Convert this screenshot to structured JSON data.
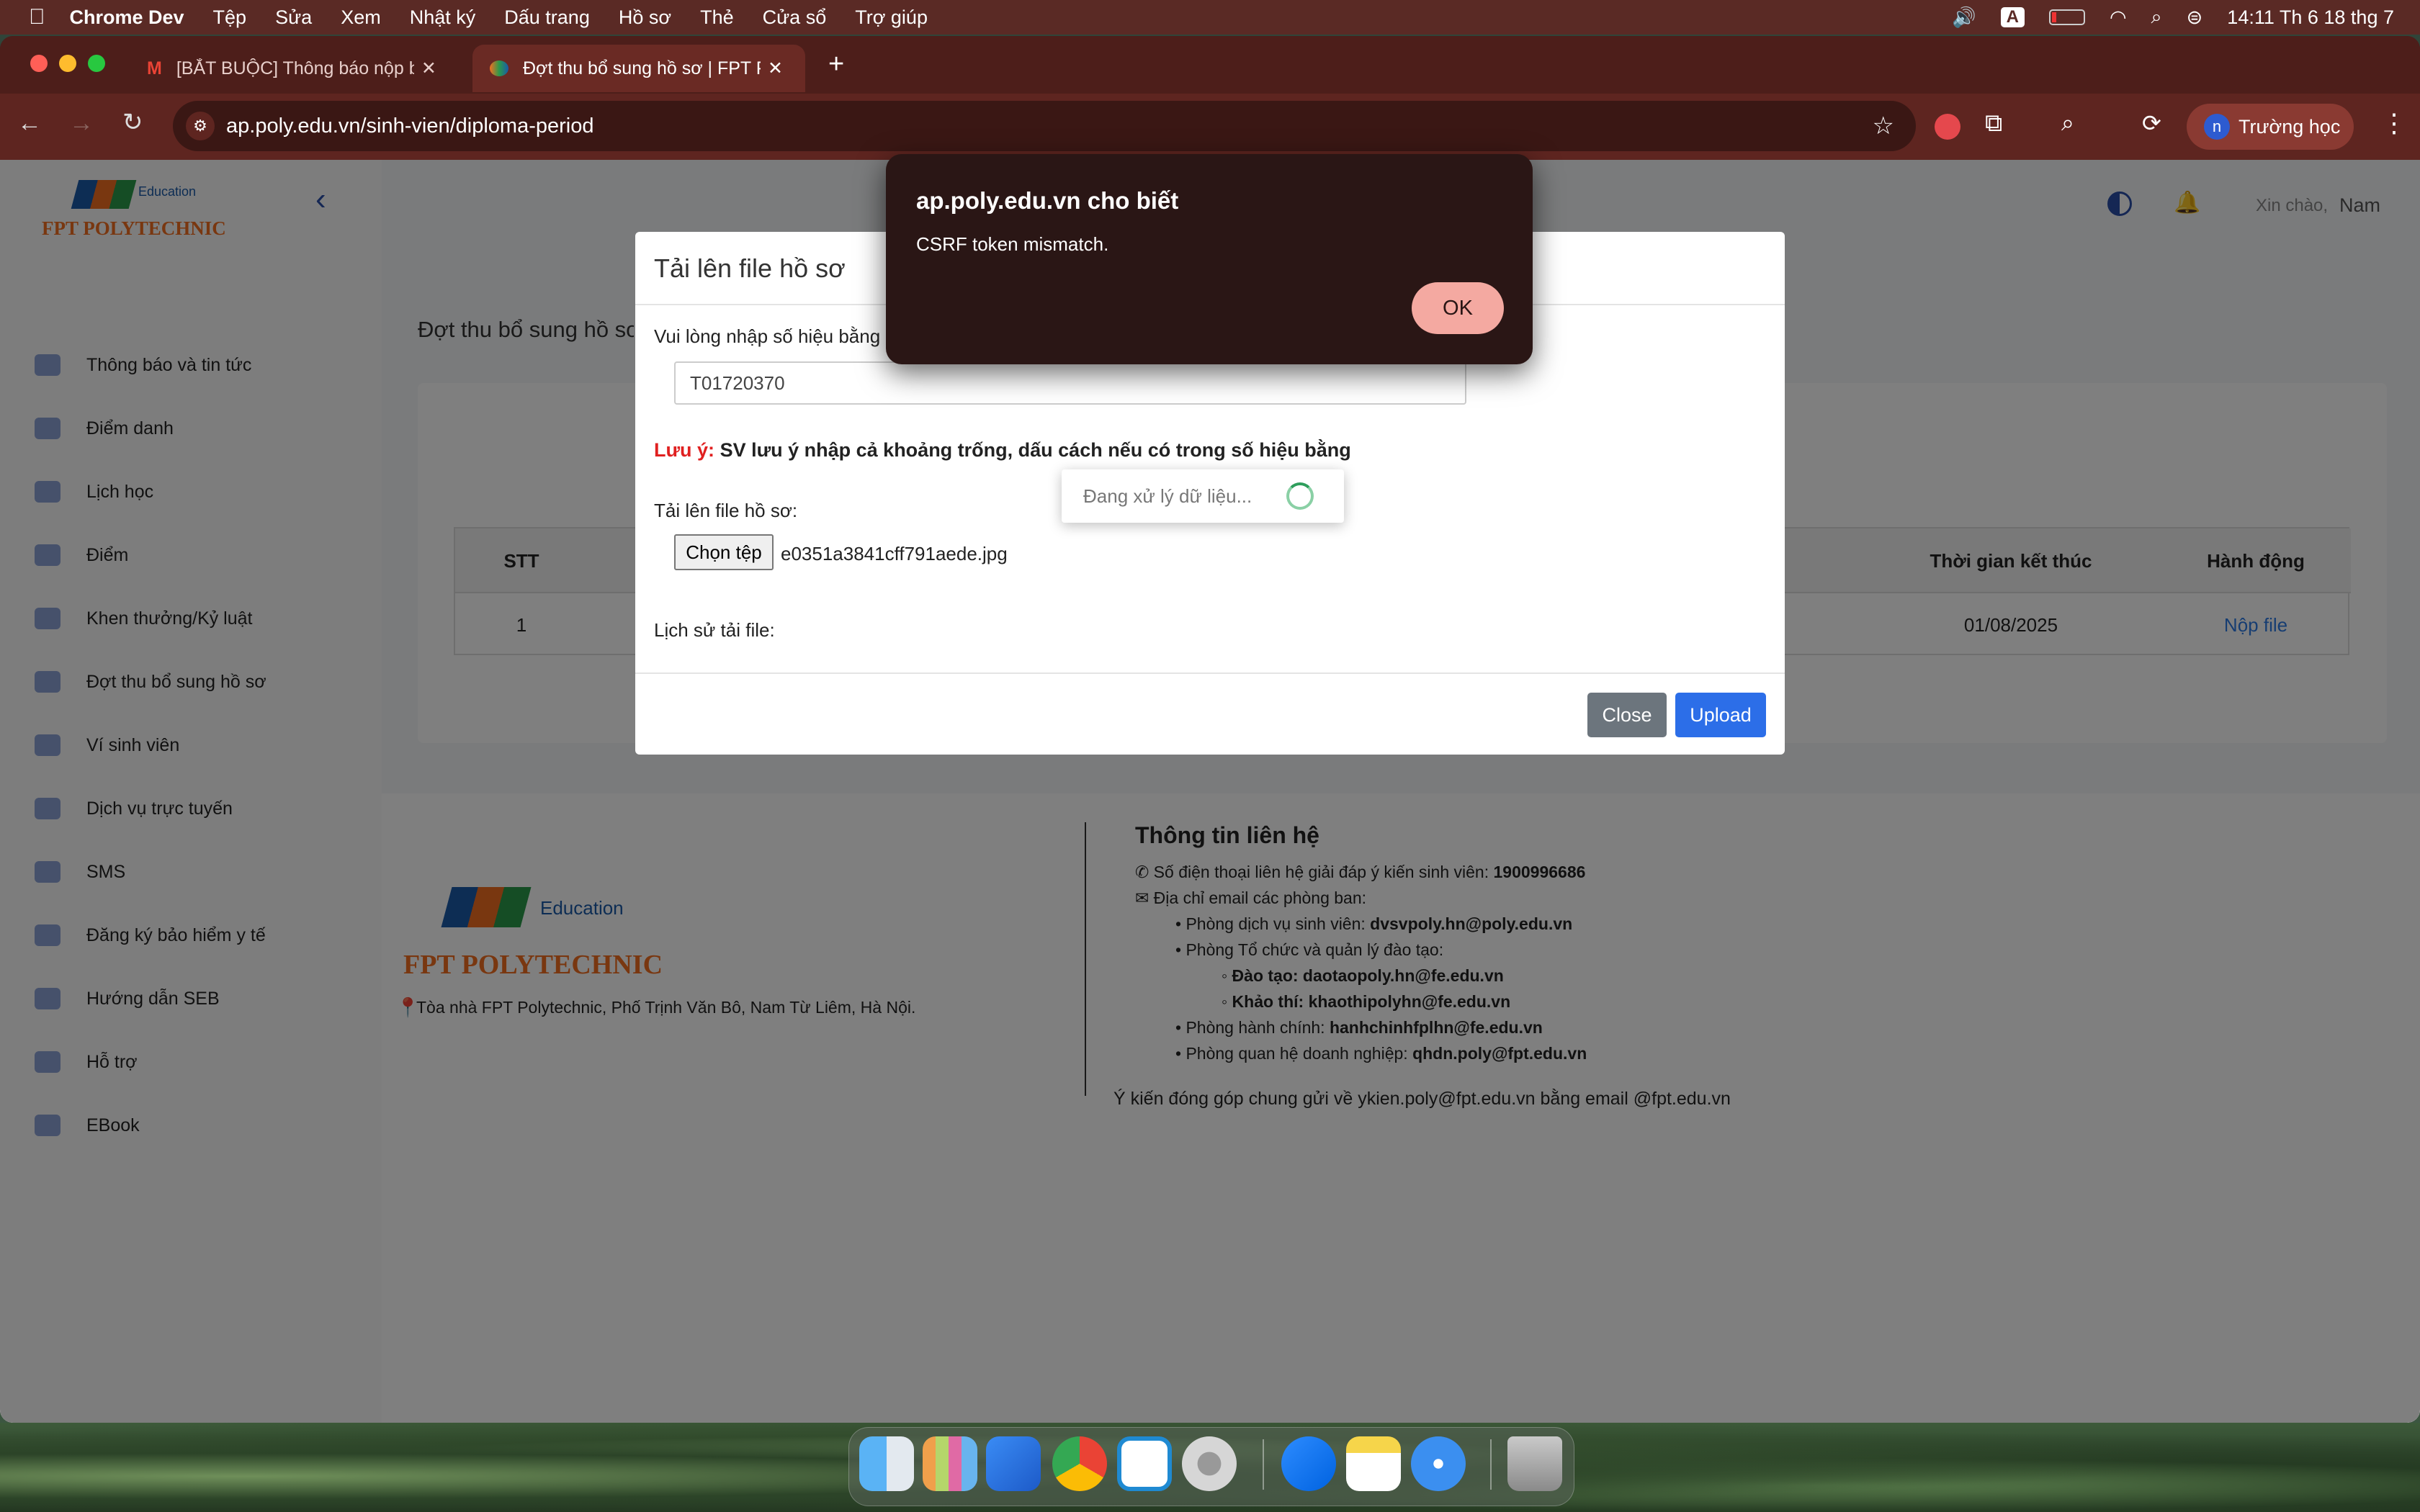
{
  "menubar": {
    "app_name": "Chrome Dev",
    "items": [
      "Tệp",
      "Sửa",
      "Xem",
      "Nhật ký",
      "Dấu trang",
      "Hồ sơ",
      "Thẻ",
      "Cửa sổ",
      "Trợ giúp"
    ],
    "input_indicator": "A",
    "clock": "14:11 Th 6 18 thg 7"
  },
  "tabs": [
    {
      "title": "[BẮT BUỘC] Thông báo nộp b",
      "icon": "gmail-icon",
      "active": false
    },
    {
      "title": "Đợt thu bổ sung hồ sơ | FPT P",
      "icon": "fpt-icon",
      "active": true
    }
  ],
  "toolbar": {
    "url": "ap.poly.edu.vn/sinh-vien/diploma-period",
    "profile_initial": "n",
    "profile_label": "Trường học"
  },
  "sidebar": {
    "logo_main": "FPT POLYTECHNIC",
    "logo_sub": "Education",
    "items": [
      {
        "label": "Thông báo và tin tức",
        "icon": "bell-icon"
      },
      {
        "label": "Điểm danh",
        "icon": "check-icon"
      },
      {
        "label": "Lịch học",
        "icon": "list-icon"
      },
      {
        "label": "Điểm",
        "icon": "chart-icon"
      },
      {
        "label": "Khen thưởng/Kỷ luật",
        "icon": "heart-icon"
      },
      {
        "label": "Đợt thu bổ sung hồ sơ",
        "icon": "heart-icon"
      },
      {
        "label": "Ví sinh viên",
        "icon": "wallet-icon"
      },
      {
        "label": "Dịch vụ trực tuyến",
        "icon": "globe-icon"
      },
      {
        "label": "SMS",
        "icon": "phone-icon"
      },
      {
        "label": "Đăng ký bảo hiểm y tế",
        "icon": "document-icon"
      },
      {
        "label": "Hướng dẫn SEB",
        "icon": "google-icon"
      },
      {
        "label": "Hỗ trợ",
        "icon": "help-icon"
      },
      {
        "label": "EBook",
        "icon": "book-icon"
      }
    ]
  },
  "header": {
    "greeting": "Xin chào,",
    "username": "Nam"
  },
  "main": {
    "page_title": "Đợt thu bổ sung hồ sơ",
    "table": {
      "headers": [
        "STT",
        "Thời gian kết thúc",
        "Hành động"
      ],
      "rows": [
        {
          "stt": "1",
          "end_time": "01/08/2025",
          "action": "Nộp file"
        }
      ]
    }
  },
  "modal": {
    "title": "Tải lên file hồ sơ",
    "prompt": "Vui lòng nhập số hiệu bằng",
    "input_value": "T01720370",
    "note_label": "Lưu ý:",
    "note_text": "SV lưu ý nhập cả khoảng trống, dấu cách nếu có trong số hiệu bằng",
    "upload_label": "Tải lên file hồ sơ:",
    "choose_file_label": "Chọn tệp",
    "file_name": "e0351a3841cff791aede.jpg",
    "history_label": "Lịch sử tải file:",
    "close_label": "Close",
    "upload_button_label": "Upload",
    "processing_text": "Đang xử lý dữ liệu..."
  },
  "alert": {
    "title": "ap.poly.edu.vn cho biết",
    "message": "CSRF token mismatch.",
    "ok_label": "OK"
  },
  "footer": {
    "logo_main": "FPT POLYTECHNIC",
    "logo_sub": "Education",
    "address": "Tòa nhà FPT Polytechnic, Phố Trịnh Văn Bô, Nam Từ Liêm, Hà Nội.",
    "contact_title": "Thông tin liên hệ",
    "hotline_label": "Số điện thoại liên hệ giải đáp ý kiến sinh viên:",
    "hotline": "1900996686",
    "email_label": "Địa chỉ email các phòng ban:",
    "dept1_label": "Phòng dịch vụ sinh viên:",
    "dept1_email": "dvsvpoly.hn@poly.edu.vn",
    "dept2_label": "Phòng Tổ chức và quản lý đào tạo:",
    "dept2a": "Đào tạo: daotaopoly.hn@fe.edu.vn",
    "dept2b": "Khảo thí: khaothipolyhn@fe.edu.vn",
    "dept3_label": "Phòng hành chính:",
    "dept3_email": "hanhchinhfplhn@fe.edu.vn",
    "dept4_label": "Phòng quan hệ doanh nghiệp:",
    "dept4_email": "qhdn.poly@fpt.edu.vn",
    "feedback": "Ý kiến đóng góp chung gửi về ykien.poly@fpt.edu.vn bằng email @fpt.edu.vn"
  },
  "dock": [
    "finder-icon",
    "launchpad-icon",
    "xcode-icon",
    "chrome-icon",
    "vscode-icon",
    "system-settings-icon",
    "messenger-icon",
    "notes-icon",
    "safari-icon",
    "trash-icon"
  ]
}
